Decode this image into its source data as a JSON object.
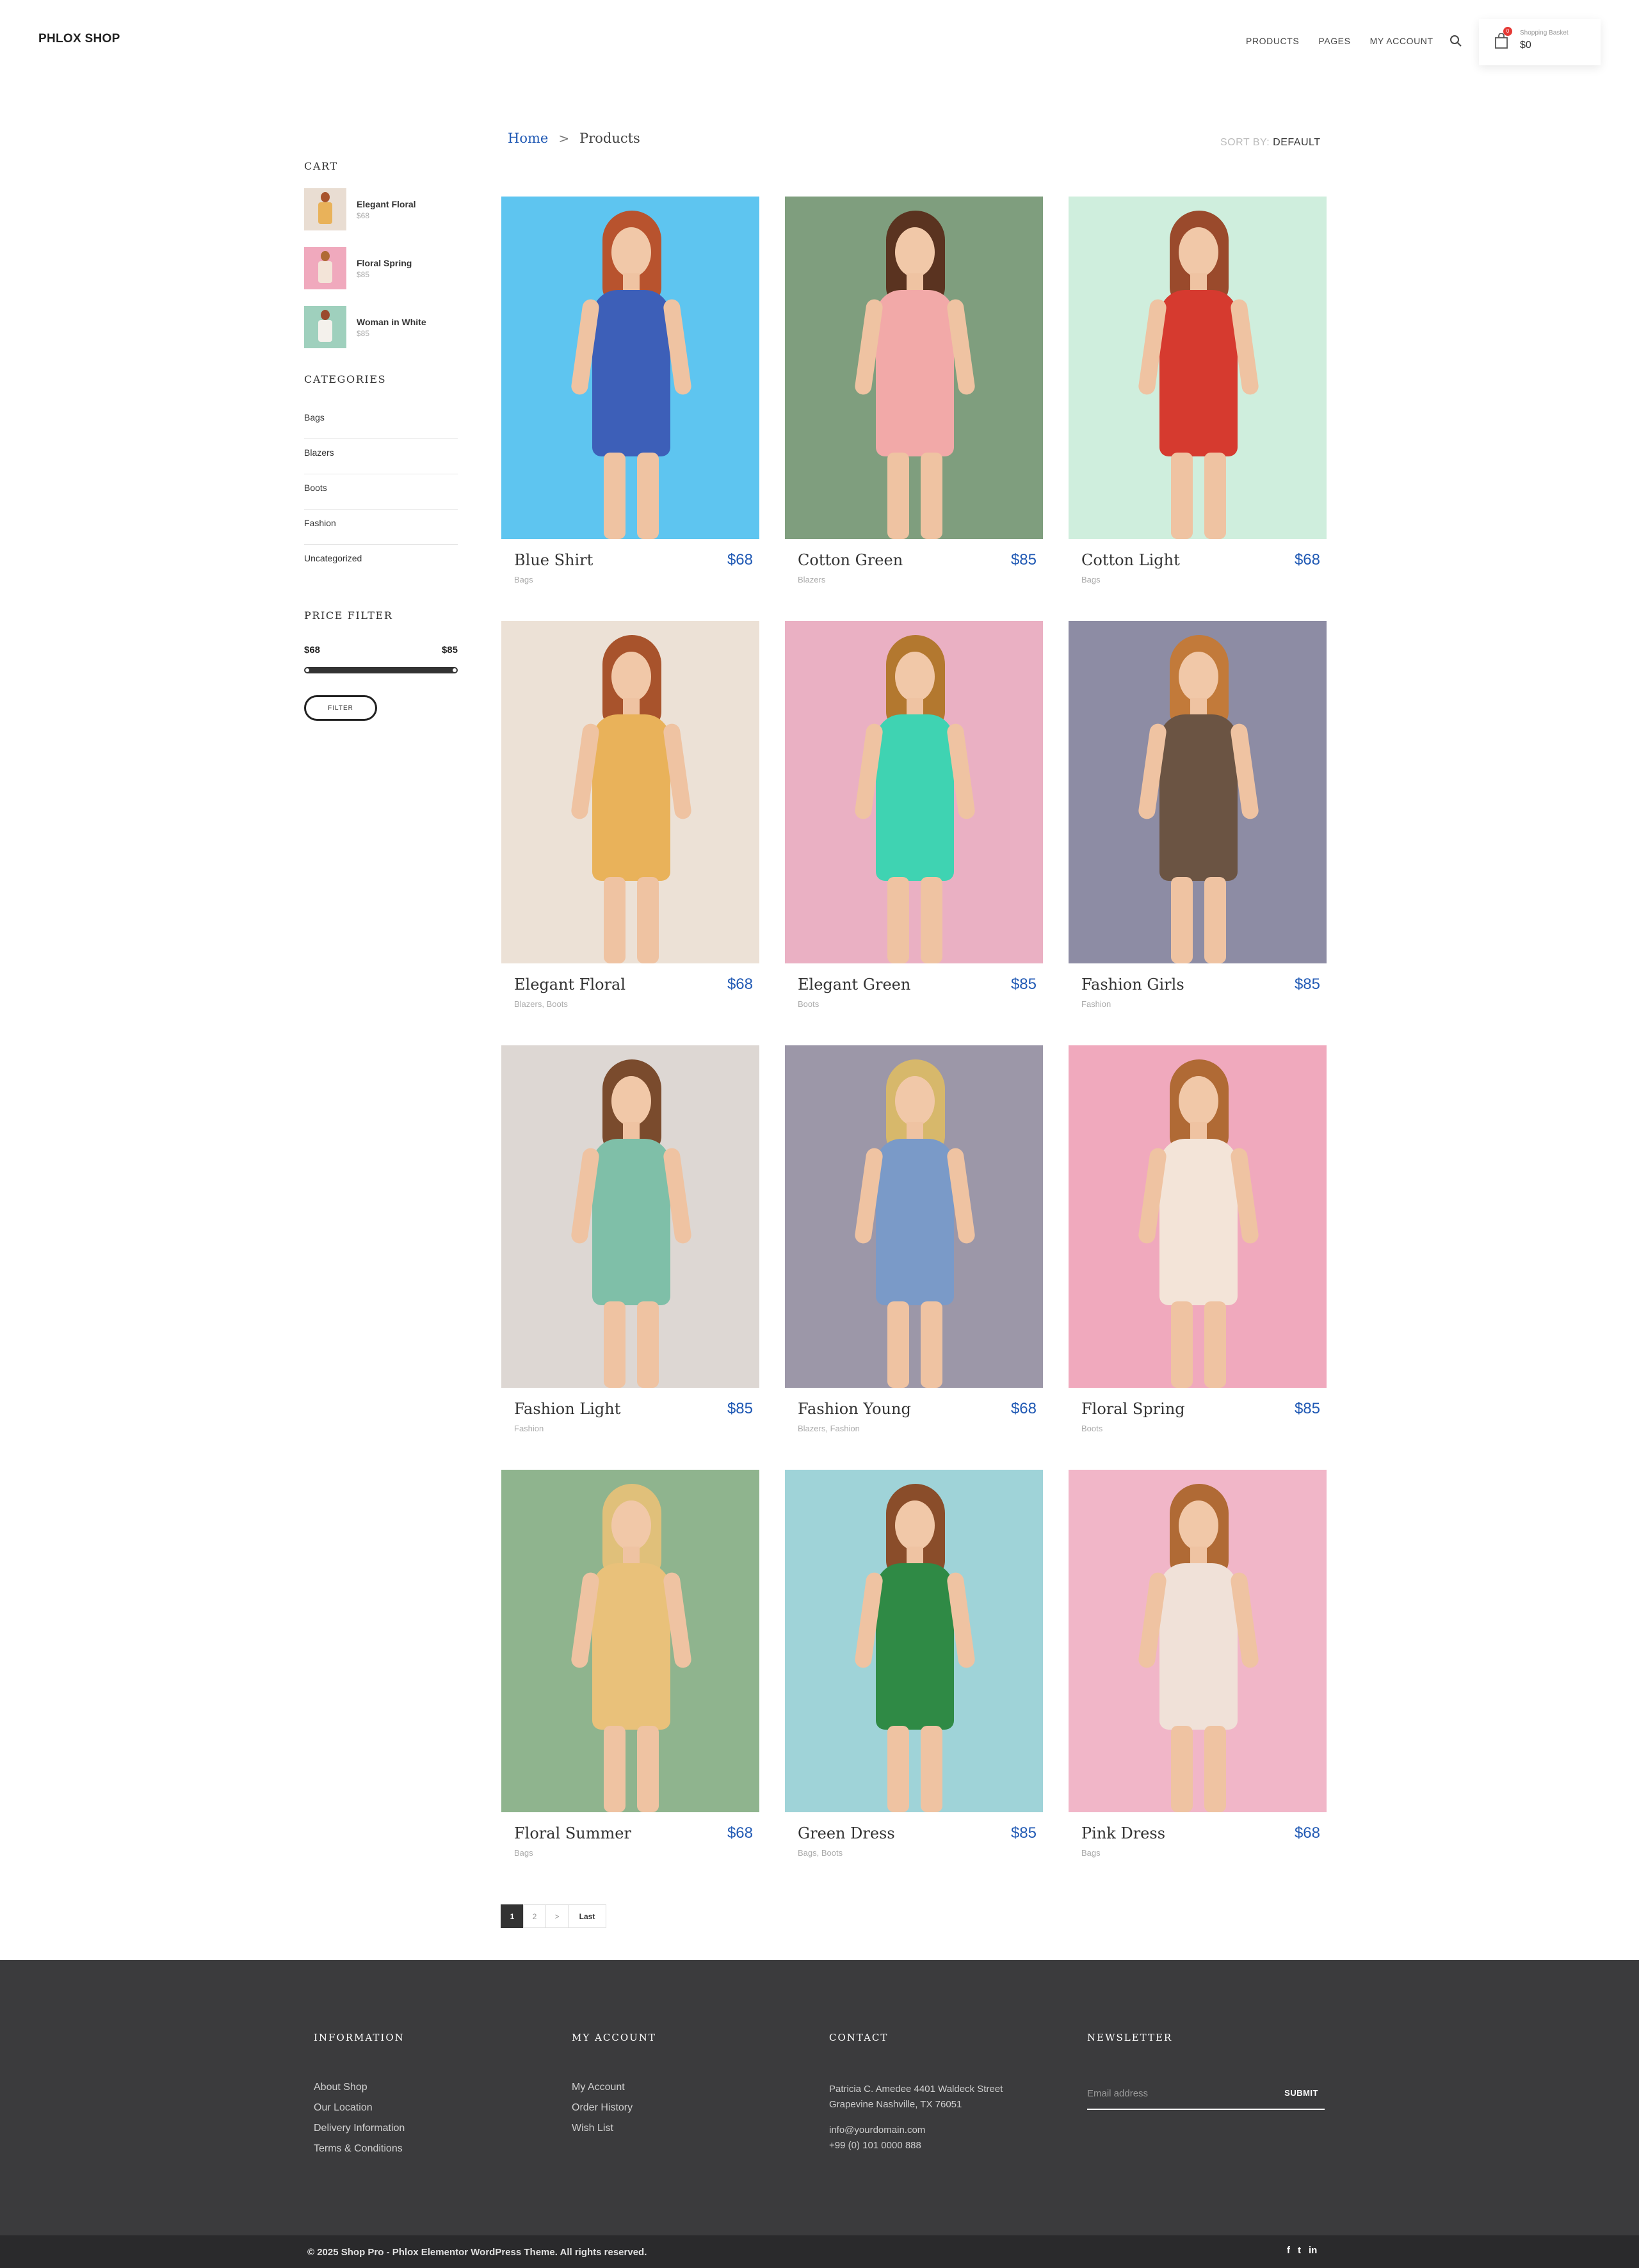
{
  "header": {
    "logo": "PHLOX SHOP",
    "nav": [
      "PRODUCTS",
      "PAGES",
      "MY ACCOUNT"
    ],
    "cart": {
      "badge": "0",
      "label": "Shopping Basket",
      "total": "$0"
    }
  },
  "breadcrumb": {
    "home": "Home",
    "separator": ">",
    "current": "Products"
  },
  "sort": {
    "label": "SORT BY:",
    "value": "DEFAULT"
  },
  "sidebar": {
    "cart_title": "CART",
    "cart_items": [
      {
        "name": "Elegant Floral",
        "price": "$68"
      },
      {
        "name": "Floral Spring",
        "price": "$85"
      },
      {
        "name": "Woman in White",
        "price": "$85"
      }
    ],
    "categories_title": "CATEGORIES",
    "categories": [
      "Bags",
      "Blazers",
      "Boots",
      "Fashion",
      "Uncategorized"
    ],
    "price_filter_title": "PRICE FILTER",
    "price_min": "$68",
    "price_max": "$85",
    "filter_button": "FILTER"
  },
  "products": [
    {
      "name": "Blue Shirt",
      "price": "$68",
      "cats": "Bags",
      "bg": "#5ec5f0",
      "dress": "#3d5fb8",
      "hair": "#b8532e"
    },
    {
      "name": "Cotton Green",
      "price": "$85",
      "cats": "Blazers",
      "bg": "#7f9e7e",
      "dress": "#f2a9a8",
      "hair": "#5a3320"
    },
    {
      "name": "Cotton Light",
      "price": "$68",
      "cats": "Bags",
      "bg": "#cfeedd",
      "dress": "#d63a2f",
      "hair": "#9a4a2c"
    },
    {
      "name": "Elegant Floral",
      "price": "$68",
      "cats": "Blazers, Boots",
      "bg": "#ece1d6",
      "dress": "#e9b25a",
      "hair": "#a8532c"
    },
    {
      "name": "Elegant Green",
      "price": "$85",
      "cats": "Boots",
      "bg": "#eab0c3",
      "dress": "#3fd3b2",
      "hair": "#b3782f"
    },
    {
      "name": "Fashion Girls",
      "price": "$85",
      "cats": "Fashion",
      "bg": "#8d8ca4",
      "dress": "#6b5443",
      "hair": "#c27a3a"
    },
    {
      "name": "Fashion Light",
      "price": "$85",
      "cats": "Fashion",
      "bg": "#ddd7d3",
      "dress": "#7fbfa8",
      "hair": "#7a4b2d"
    },
    {
      "name": "Fashion Young",
      "price": "$68",
      "cats": "Blazers, Fashion",
      "bg": "#9c97a8",
      "dress": "#7a9ac8",
      "hair": "#d7b86b"
    },
    {
      "name": "Floral Spring",
      "price": "$85",
      "cats": "Boots",
      "bg": "#f0a9bd",
      "dress": "#f3e4d8",
      "hair": "#b06a35"
    },
    {
      "name": "Floral Summer",
      "price": "$68",
      "cats": "Bags",
      "bg": "#8fb48e",
      "dress": "#e9c17a",
      "hair": "#e0c07a"
    },
    {
      "name": "Green Dress",
      "price": "$85",
      "cats": "Bags, Boots",
      "bg": "#9fd3d8",
      "dress": "#2f8a45",
      "hair": "#8a4d2a"
    },
    {
      "name": "Pink Dress",
      "price": "$68",
      "cats": "Bags",
      "bg": "#f1b6c8",
      "dress": "#f0e1d8",
      "hair": "#b06a35"
    }
  ],
  "pagination": [
    "1",
    "2",
    ">",
    "Last"
  ],
  "footer": {
    "information": {
      "title": "INFORMATION",
      "links": [
        "About Shop",
        "Our Location",
        "Delivery Information",
        "Terms & Conditions"
      ]
    },
    "account": {
      "title": "MY ACCOUNT",
      "links": [
        "My Account",
        "Order History",
        "Wish List"
      ]
    },
    "contact": {
      "title": "CONTACT",
      "address1": "Patricia C. Amedee 4401 Waldeck Street",
      "address2": "Grapevine Nashville, TX 76051",
      "email": "info@yourdomain.com",
      "phone": "+99 (0) 101 0000 888"
    },
    "newsletter": {
      "title": "NEWSLETTER",
      "placeholder": "Email address",
      "submit": "SUBMIT"
    }
  },
  "bottom": {
    "copyright": "© 2025 Shop Pro - Phlox Elementor WordPress Theme. All rights reserved.",
    "social": [
      "f",
      "t",
      "in"
    ]
  }
}
